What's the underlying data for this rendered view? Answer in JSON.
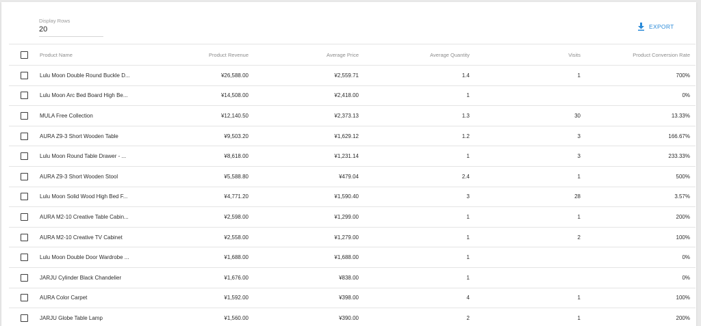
{
  "display_rows": {
    "label": "Display Rows",
    "value": "20"
  },
  "export": {
    "label": "EXPORT",
    "icon": "download-icon",
    "color": "#2a8ad8"
  },
  "columns": {
    "name": "Product Name",
    "revenue": "Product Revenue",
    "avg_price": "Average Price",
    "avg_qty": "Average Quantity",
    "visits": "Visits",
    "rate": "Product Conversion Rate"
  },
  "rows": [
    {
      "name": "Lulu Moon Double Round Buckle D...",
      "revenue": "¥26,588.00",
      "avg_price": "¥2,559.71",
      "avg_qty": "1.4",
      "visits": "1",
      "rate": "700%"
    },
    {
      "name": "Lulu Moon Arc Bed Board High Be...",
      "revenue": "¥14,508.00",
      "avg_price": "¥2,418.00",
      "avg_qty": "1",
      "visits": "",
      "rate": "0%"
    },
    {
      "name": "MULA Free Collection",
      "revenue": "¥12,140.50",
      "avg_price": "¥2,373.13",
      "avg_qty": "1.3",
      "visits": "30",
      "rate": "13.33%"
    },
    {
      "name": "AURA Z9-3 Short Wooden Table",
      "revenue": "¥9,503.20",
      "avg_price": "¥1,629.12",
      "avg_qty": "1.2",
      "visits": "3",
      "rate": "166.67%"
    },
    {
      "name": "Lulu Moon Round Table Drawer - ...",
      "revenue": "¥8,618.00",
      "avg_price": "¥1,231.14",
      "avg_qty": "1",
      "visits": "3",
      "rate": "233.33%"
    },
    {
      "name": "AURA Z9-3 Short Wooden Stool",
      "revenue": "¥5,588.80",
      "avg_price": "¥479.04",
      "avg_qty": "2.4",
      "visits": "1",
      "rate": "500%"
    },
    {
      "name": "Lulu Moon Solid Wood High Bed F...",
      "revenue": "¥4,771.20",
      "avg_price": "¥1,590.40",
      "avg_qty": "3",
      "visits": "28",
      "rate": "3.57%"
    },
    {
      "name": "AURA M2-10 Creative Table Cabin...",
      "revenue": "¥2,598.00",
      "avg_price": "¥1,299.00",
      "avg_qty": "1",
      "visits": "1",
      "rate": "200%"
    },
    {
      "name": "AURA M2-10 Creative TV Cabinet",
      "revenue": "¥2,558.00",
      "avg_price": "¥1,279.00",
      "avg_qty": "1",
      "visits": "2",
      "rate": "100%"
    },
    {
      "name": "Lulu Moon Double Door Wardrobe ...",
      "revenue": "¥1,688.00",
      "avg_price": "¥1,688.00",
      "avg_qty": "1",
      "visits": "",
      "rate": "0%"
    },
    {
      "name": "JARJU Cylinder Black Chandelier",
      "revenue": "¥1,676.00",
      "avg_price": "¥838.00",
      "avg_qty": "1",
      "visits": "",
      "rate": "0%"
    },
    {
      "name": "AURA Color Carpet",
      "revenue": "¥1,592.00",
      "avg_price": "¥398.00",
      "avg_qty": "4",
      "visits": "1",
      "rate": "100%"
    },
    {
      "name": "JARJU Globe Table Lamp",
      "revenue": "¥1,560.00",
      "avg_price": "¥390.00",
      "avg_qty": "2",
      "visits": "1",
      "rate": "200%"
    }
  ]
}
